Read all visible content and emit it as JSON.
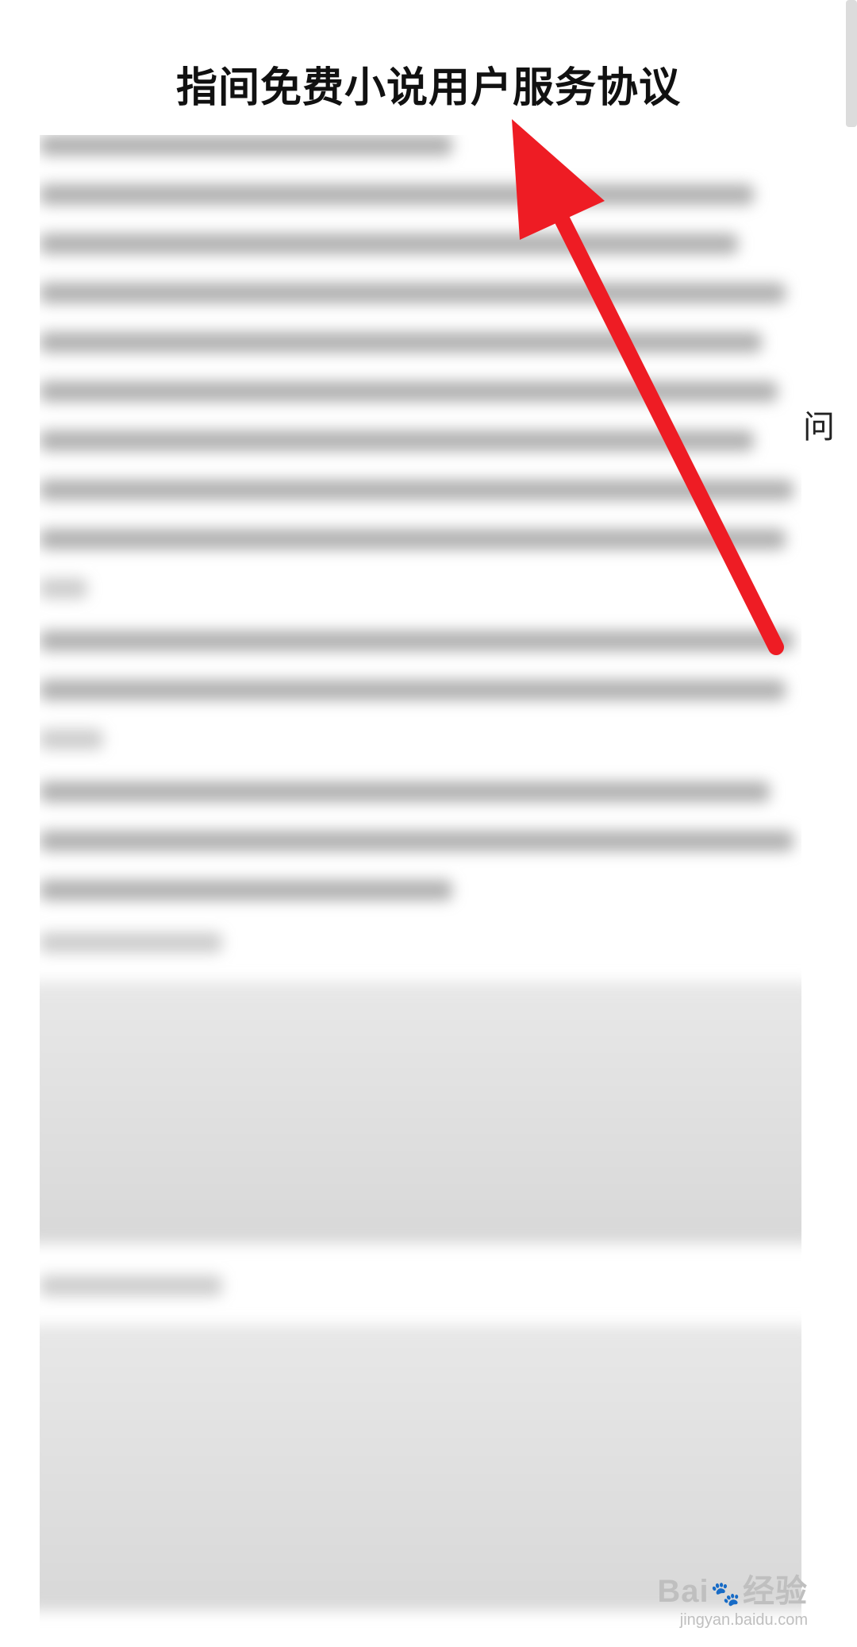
{
  "document": {
    "title": "指间免费小说用户服务协议",
    "edge_char": "问"
  },
  "annotation": {
    "arrow_color": "#ee1c24"
  },
  "watermark": {
    "logo_left": "Bai",
    "logo_right": "经验",
    "url": "jingyan.baidu.com"
  }
}
